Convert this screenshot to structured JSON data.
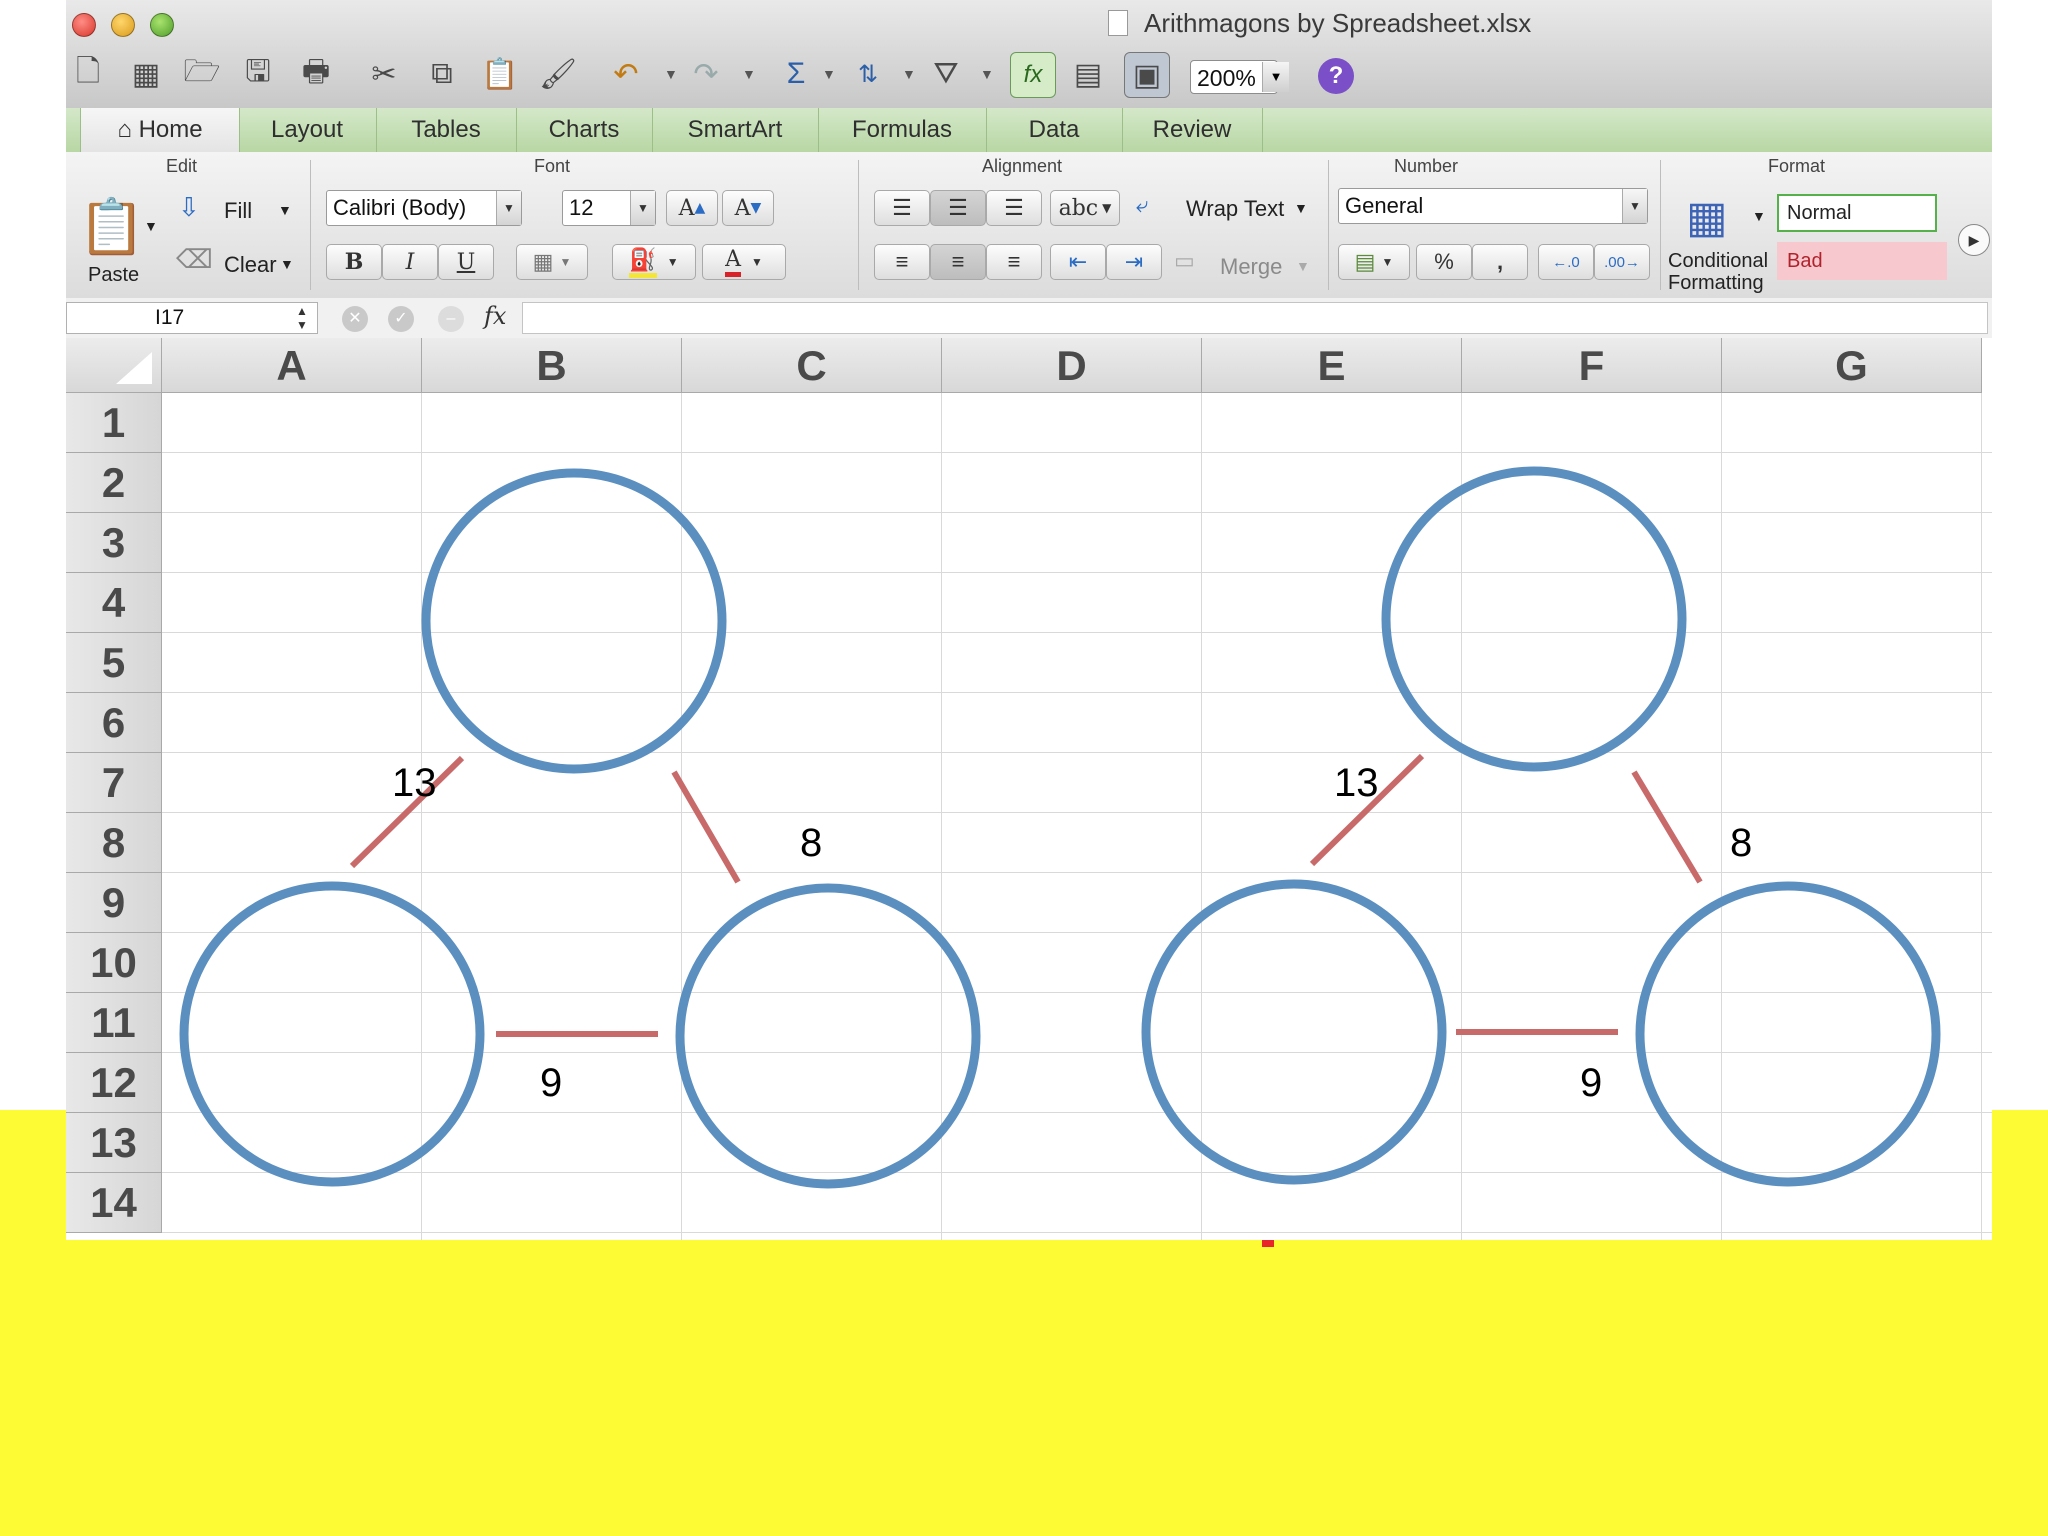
{
  "window": {
    "title": "Arithmagons by Spreadsheet.xlsx"
  },
  "toolbar": {
    "zoom": "200%"
  },
  "ribbon": {
    "tabs": [
      "Home",
      "Layout",
      "Tables",
      "Charts",
      "SmartArt",
      "Formulas",
      "Data",
      "Review"
    ],
    "groups": {
      "edit": "Edit",
      "font": "Font",
      "alignment": "Alignment",
      "number": "Number",
      "format": "Format"
    },
    "edit": {
      "paste": "Paste",
      "fill": "Fill",
      "clear": "Clear"
    },
    "font": {
      "name": "Calibri (Body)",
      "size": "12",
      "bold": "B",
      "italic": "I",
      "underline": "U",
      "grow": "A",
      "shrink": "A",
      "color": "A"
    },
    "alignment": {
      "orientation": "abc",
      "wrap_text": "Wrap Text",
      "merge": "Merge"
    },
    "number": {
      "format": "General",
      "percent": "%",
      "comma": ","
    },
    "format": {
      "conditional_line1": "Conditional",
      "conditional_line2": "Formatting",
      "style_normal": "Normal",
      "style_bad": "Bad"
    }
  },
  "formula_bar": {
    "cell_ref": "I17",
    "fx": "fx",
    "content": ""
  },
  "sheet": {
    "columns": [
      "A",
      "B",
      "C",
      "D",
      "E",
      "F",
      "G"
    ],
    "rows": [
      "1",
      "2",
      "3",
      "4",
      "5",
      "6",
      "7",
      "8",
      "9",
      "10",
      "11",
      "12",
      "13",
      "14"
    ]
  },
  "arithmagons": [
    {
      "left_edge": "13",
      "right_edge": "8",
      "bottom_edge": "9"
    },
    {
      "left_edge": "13",
      "right_edge": "8",
      "bottom_edge": "9"
    }
  ],
  "colors": {
    "circle": "#5b8fc0",
    "edge": "#c96a6a",
    "ribbon_tab": "#c3dfb1",
    "band": "#fdfb33"
  }
}
